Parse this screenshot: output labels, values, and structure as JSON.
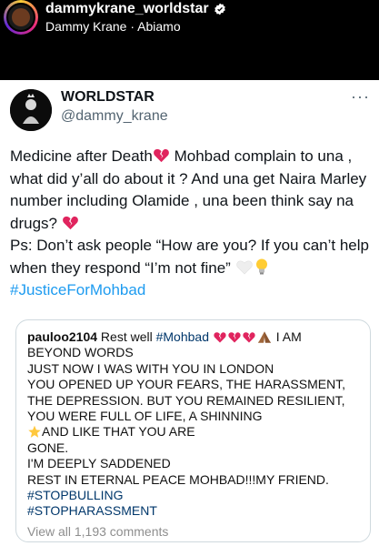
{
  "ig": {
    "username": "dammykrane_worldstar",
    "subtitle": "Dammy Krane · Abiamo"
  },
  "tweet": {
    "name": "WORLDSTAR",
    "handle": "@dammy_krane",
    "more": "···",
    "para1_a": "Medicine after Death",
    "para1_b": " Mohbad complain to una , what did y’all do about it ? And una get Naira Marley number including Olamide , una been think say na drugs? ",
    "para2": "Ps: Don’t ask people “How are you?  If you can’t help when they respond “I’m not fine” ",
    "hashtag": "#JusticeForMohbad"
  },
  "quote": {
    "user": "pauloo2104",
    "line1_text": " Rest well ",
    "line1_tag": "#Mohbad",
    "line1_tail": " I AM",
    "line2": "BEYOND WORDS",
    "line3": "JUST NOW I WAS WITH YOU IN LONDON",
    "line4": "YOU OPENED UP YOUR FEARS, THE HARASSMENT,",
    "line5": "THE DEPRESSION. BUT YOU REMAINED RESILIENT,",
    "line6": "YOU WERE FULL OF LIFE, A SHINNING",
    "line7": "AND LIKE THAT YOU ARE",
    "line8": "GONE.",
    "line9": "I'M DEEPLY SADDENED",
    "line10": "REST IN ETERNAL PEACE MOHBAD!!!MY FRIEND.",
    "tag1": "#STOPBULLING",
    "tag2": "#STOPHARASSMENT",
    "comments": "View all 1,193 comments"
  },
  "colors": {
    "hashtag": "#1d9bf0",
    "quote_tag": "#00376b",
    "broken_heart": "#e0245e"
  },
  "icons": [
    "verified-badge-icon",
    "broken-heart-icon",
    "white-heart-icon",
    "lightbulb-icon",
    "praying-hands-icon",
    "star-icon",
    "more-dots-icon"
  ]
}
